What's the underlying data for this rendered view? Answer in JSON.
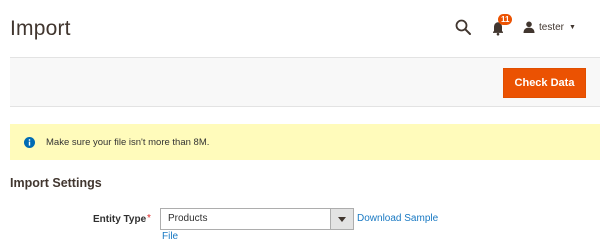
{
  "header": {
    "title": "Import",
    "notifications_count": "11",
    "user_name": "tester",
    "icons": {
      "search": "search-icon",
      "bell": "bell-icon",
      "user": "user-icon",
      "caret": "caret-down-icon"
    }
  },
  "actions": {
    "check_data_label": "Check Data"
  },
  "notice": {
    "icon": "info-icon",
    "text": "Make sure your file isn't more than 8M."
  },
  "import_settings": {
    "title": "Import Settings",
    "entity_type": {
      "label": "Entity Type",
      "required_mark": "*",
      "selected": "Products",
      "download_link_part1": "Download Sample",
      "download_link_part2": "File"
    }
  },
  "colors": {
    "accent": "#eb5202",
    "link": "#1979c3",
    "notice_bg": "#fffbbb",
    "required": "#e22626"
  }
}
